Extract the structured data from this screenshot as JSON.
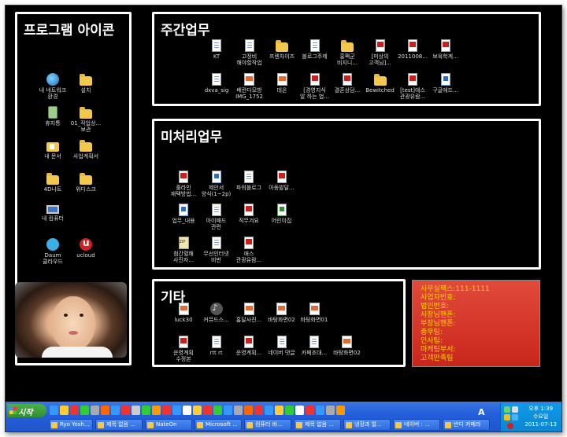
{
  "panels": {
    "program_icons": {
      "title": "프로그램 아이콘",
      "icons": [
        {
          "label": "내 네트워크\n환경",
          "icon": "network-icon"
        },
        {
          "label": "설치",
          "icon": "folder-icon"
        },
        {
          "label": "휴지통",
          "icon": "recycle-bin-icon"
        },
        {
          "label": "01_작업상...\n보관",
          "icon": "folder-icon"
        },
        {
          "label": "내 문서",
          "icon": "my-documents-icon"
        },
        {
          "label": "사업계획서",
          "icon": "folder-icon"
        },
        {
          "label": "4D나트",
          "icon": "folder-icon"
        },
        {
          "label": "위디스크",
          "icon": "folder-icon"
        },
        {
          "label": "내 컴퓨터",
          "icon": "computer-icon"
        },
        {
          "label": "Daum\n클라우드",
          "icon": "daum-cloud-icon"
        },
        {
          "label": "ucloud",
          "icon": "ucloud-icon"
        }
      ]
    },
    "weekly_work": {
      "title": "주간업무",
      "row1": [
        {
          "label": "KT",
          "icon": "document-icon"
        },
        {
          "label": "고정비\n해야할작업",
          "icon": "document-icon"
        },
        {
          "label": "프렌차이즈",
          "icon": "folder-icon"
        },
        {
          "label": "블로그주제",
          "icon": "document-icon"
        },
        {
          "label": "홍팩군\n비지니...",
          "icon": "folder-icon"
        },
        {
          "label": "[미상의\n고객님]...",
          "icon": "pdf-icon"
        },
        {
          "label": "2011008...",
          "icon": "pdf-icon"
        },
        {
          "label": "보육학계...",
          "icon": "pdf-icon"
        }
      ],
      "row2": [
        {
          "label": "dxva_sig",
          "icon": "document-icon"
        },
        {
          "label": "베란다모방\nIMG_1752",
          "icon": "image-icon"
        },
        {
          "label": "데온",
          "icon": "image-icon"
        },
        {
          "label": "[경영지식\n알 하는 법...",
          "icon": "pdf-icon"
        },
        {
          "label": "결혼상담...",
          "icon": "pdf-icon"
        },
        {
          "label": "Bewitched",
          "icon": "folder-icon"
        },
        {
          "label": "[test]애스\n관광유람...",
          "icon": "pdf-icon"
        },
        {
          "label": "구글애드...",
          "icon": "hwp-icon"
        }
      ]
    },
    "pending_work": {
      "title": "미처리업무",
      "row1": [
        {
          "label": "훌라인\n재택방법...",
          "icon": "pdf-icon"
        },
        {
          "label": "제안서\n양식(1~2p)",
          "icon": "hwp-icon"
        },
        {
          "label": "파워블로그",
          "icon": "document-icon"
        },
        {
          "label": "아동발달...",
          "icon": "pdf-icon"
        }
      ],
      "row2": [
        {
          "label": "업무_내용",
          "icon": "hwp-icon"
        },
        {
          "label": "아이패드\n관련",
          "icon": "document-icon"
        },
        {
          "label": "직무겨요",
          "icon": "pdf-icon"
        },
        {
          "label": "어린이집",
          "icon": "excel-icon"
        }
      ],
      "row3": [
        {
          "label": "첨간혈해\n사진자...",
          "icon": "zip-icon"
        },
        {
          "label": "무선인터넷\n비번",
          "icon": "document-icon"
        },
        {
          "label": "애스\n관광유람...",
          "icon": "pdf-icon"
        }
      ]
    },
    "other": {
      "title": "기타",
      "row1": [
        {
          "label": "luck30",
          "icon": "image-icon"
        },
        {
          "label": "커뮤드스...",
          "icon": "mp3-icon"
        },
        {
          "label": "홈달사진...",
          "icon": "image-icon"
        },
        {
          "label": "바탕화면02",
          "icon": "image-icon"
        },
        {
          "label": "바탕화면01",
          "icon": "image-icon"
        }
      ],
      "row2": [
        {
          "label": "운영계획\n수정본",
          "icon": "pdf-icon"
        },
        {
          "label": "rtt rt",
          "icon": "document-icon"
        },
        {
          "label": "운영계획...",
          "icon": "pdf-icon"
        },
        {
          "label": "네이버 댓글",
          "icon": "document-icon"
        },
        {
          "label": "카페조대...",
          "icon": "document-icon"
        },
        {
          "label": "바탕화면02",
          "icon": "image-icon"
        }
      ]
    }
  },
  "memo": {
    "lines": [
      "사무실팩스:111-1111",
      "사업자번호:",
      "법인번호:",
      "사장님핸폰:",
      "부장님핸폰:",
      "총무팀:",
      "인사팀:",
      "마케팅부서:",
      "고객만족팀"
    ]
  },
  "taskbar": {
    "start_label": "시작",
    "tasks": [
      "Ryo Yosh...",
      "제목 없음 ...",
      "NateOn",
      "Microsoft ...",
      "컴퓨터 바...",
      "제목 없음 ...",
      "냉장과 얼...",
      "네이버 : ...",
      "반디 카메라"
    ],
    "language": "A",
    "clock_time": "오후 1:39",
    "clock_day": "수요일",
    "clock_date": "2011-07-13"
  },
  "colors": {
    "desktop_bg": "#000000",
    "panel_border": "#ffffff",
    "memo_bg": "#d9352a",
    "memo_text": "#ffd400",
    "taskbar": "#245edb"
  }
}
